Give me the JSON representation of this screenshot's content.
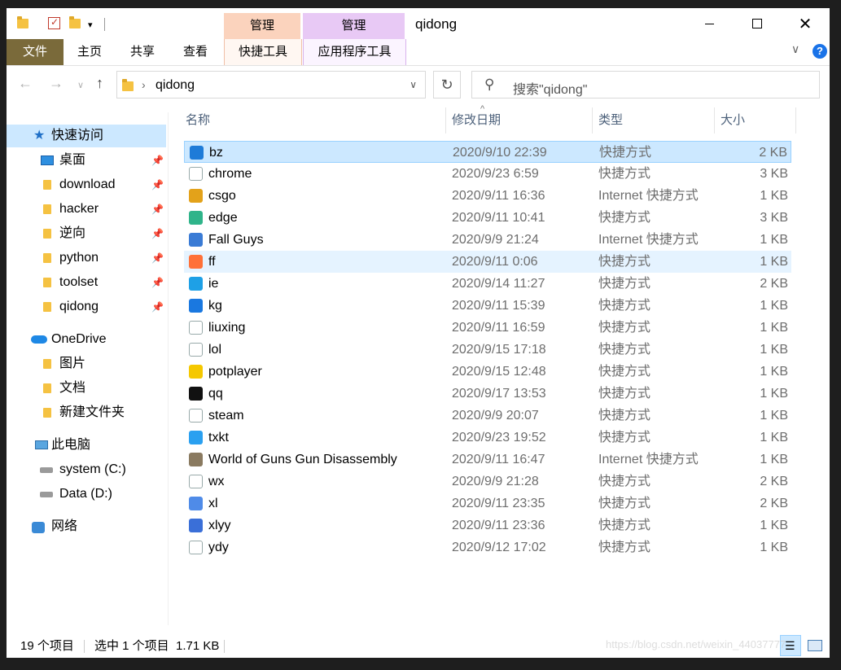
{
  "window": {
    "title": "qidong"
  },
  "title_tabs": {
    "manage1": "管理",
    "manage2": "管理"
  },
  "ribbon": {
    "file": "文件",
    "home": "主页",
    "share": "共享",
    "view": "查看",
    "shortcut_tools": "快捷工具",
    "app_tools": "应用程序工具"
  },
  "address": {
    "path": "qidong",
    "search_placeholder": "搜索\"qidong\""
  },
  "sidebar": {
    "quick_access": "快速访问",
    "items": [
      {
        "label": "桌面"
      },
      {
        "label": "download"
      },
      {
        "label": "hacker"
      },
      {
        "label": "逆向"
      },
      {
        "label": "python"
      },
      {
        "label": "toolset"
      },
      {
        "label": "qidong"
      }
    ],
    "onedrive": "OneDrive",
    "onedrive_items": [
      {
        "label": "图片"
      },
      {
        "label": "文档"
      },
      {
        "label": "新建文件夹"
      }
    ],
    "this_pc": "此电脑",
    "drives": [
      {
        "label": "system (C:)"
      },
      {
        "label": "Data (D:)"
      }
    ],
    "network": "网络"
  },
  "columns": {
    "name": "名称",
    "date": "修改日期",
    "type": "类型",
    "size": "大小"
  },
  "files": [
    {
      "name": "bz",
      "date": "2020/9/10 22:39",
      "type": "快捷方式",
      "size": "2 KB",
      "icon_color": "#1e7bd8"
    },
    {
      "name": "chrome",
      "date": "2020/9/23 6:59",
      "type": "快捷方式",
      "size": "3 KB",
      "icon_color": "#ffffff"
    },
    {
      "name": "csgo",
      "date": "2020/9/11 16:36",
      "type": "Internet 快捷方式",
      "size": "1 KB",
      "icon_color": "#e3a21a"
    },
    {
      "name": "edge",
      "date": "2020/9/11 10:41",
      "type": "快捷方式",
      "size": "3 KB",
      "icon_color": "#2fb48a"
    },
    {
      "name": "Fall Guys",
      "date": "2020/9/9 21:24",
      "type": "Internet 快捷方式",
      "size": "1 KB",
      "icon_color": "#3a7bd5"
    },
    {
      "name": "ff",
      "date": "2020/9/11 0:06",
      "type": "快捷方式",
      "size": "1 KB",
      "icon_color": "#ff7139"
    },
    {
      "name": "ie",
      "date": "2020/9/14 11:27",
      "type": "快捷方式",
      "size": "2 KB",
      "icon_color": "#1ea0e6"
    },
    {
      "name": "kg",
      "date": "2020/9/11 15:39",
      "type": "快捷方式",
      "size": "1 KB",
      "icon_color": "#1a78e0"
    },
    {
      "name": "liuxing",
      "date": "2020/9/11 16:59",
      "type": "快捷方式",
      "size": "1 KB",
      "icon_color": "#ffffff"
    },
    {
      "name": "lol",
      "date": "2020/9/15 17:18",
      "type": "快捷方式",
      "size": "1 KB",
      "icon_color": "#ffffff"
    },
    {
      "name": "potplayer",
      "date": "2020/9/15 12:48",
      "type": "快捷方式",
      "size": "1 KB",
      "icon_color": "#f5c800"
    },
    {
      "name": "qq",
      "date": "2020/9/17 13:53",
      "type": "快捷方式",
      "size": "1 KB",
      "icon_color": "#111111"
    },
    {
      "name": "steam",
      "date": "2020/9/9 20:07",
      "type": "快捷方式",
      "size": "1 KB",
      "icon_color": "#ffffff"
    },
    {
      "name": "txkt",
      "date": "2020/9/23 19:52",
      "type": "快捷方式",
      "size": "1 KB",
      "icon_color": "#2aa0f0"
    },
    {
      "name": "World of Guns Gun Disassembly",
      "date": "2020/9/11 16:47",
      "type": "Internet 快捷方式",
      "size": "1 KB",
      "icon_color": "#8a7a60"
    },
    {
      "name": "wx",
      "date": "2020/9/9 21:28",
      "type": "快捷方式",
      "size": "2 KB",
      "icon_color": "#ffffff"
    },
    {
      "name": "xl",
      "date": "2020/9/11 23:35",
      "type": "快捷方式",
      "size": "2 KB",
      "icon_color": "#4f8be8"
    },
    {
      "name": "xlyy",
      "date": "2020/9/11 23:36",
      "type": "快捷方式",
      "size": "1 KB",
      "icon_color": "#3a6fd8"
    },
    {
      "name": "ydy",
      "date": "2020/9/12 17:02",
      "type": "快捷方式",
      "size": "1 KB",
      "icon_color": "#ffffff"
    }
  ],
  "status": {
    "count": "19 个项目",
    "selected": "选中 1 个项目  1.71 KB"
  },
  "watermark": "https://blog.csdn.net/weixin_44037777"
}
